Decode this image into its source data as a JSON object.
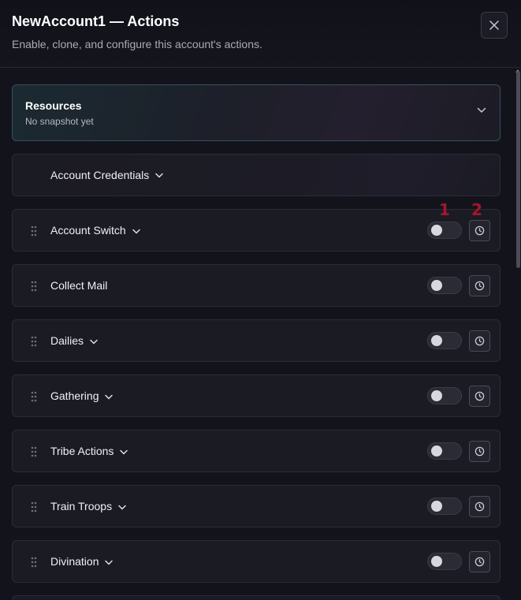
{
  "header": {
    "title": "NewAccount1 — Actions",
    "subtitle": "Enable, clone, and configure this account's actions."
  },
  "resources": {
    "title": "Resources",
    "subtitle": "No snapshot yet"
  },
  "credentials": {
    "label": "Account Credentials"
  },
  "actions": [
    {
      "label": "Account Switch",
      "has_dropdown": true,
      "enabled": false
    },
    {
      "label": "Collect Mail",
      "has_dropdown": false,
      "enabled": false
    },
    {
      "label": "Dailies",
      "has_dropdown": true,
      "enabled": false
    },
    {
      "label": "Gathering",
      "has_dropdown": true,
      "enabled": false
    },
    {
      "label": "Tribe Actions",
      "has_dropdown": true,
      "enabled": false
    },
    {
      "label": "Train Troops",
      "has_dropdown": true,
      "enabled": false
    },
    {
      "label": "Divination",
      "has_dropdown": true,
      "enabled": false
    }
  ],
  "annotations": {
    "one": "1",
    "two": "2"
  },
  "icons": {
    "close": "close-icon",
    "chevron": "chevron-down-icon",
    "drag": "drag-handle-icon",
    "schedule": "clock-icon"
  },
  "colors": {
    "annotation": "#a4162f",
    "background": "#13141b"
  }
}
